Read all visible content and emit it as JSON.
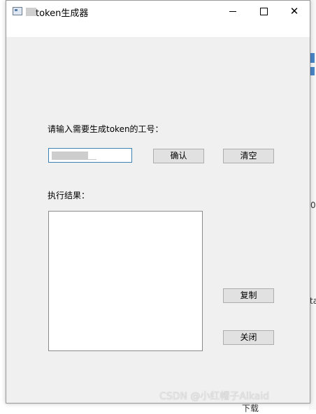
{
  "window": {
    "title": "token生成器"
  },
  "form": {
    "prompt_label": "请输入需要生成token的工号：",
    "input_value": "",
    "confirm_label": "确认",
    "clear_label": "清空",
    "result_label": "执行结果：",
    "copy_label": "复制",
    "close_label": "关闭"
  },
  "background": {
    "fragments": [
      "ta",
      "0",
      "下载"
    ]
  },
  "watermark": "CSDN @小红帽子Alkaid",
  "icons": [
    "app-icon",
    "minimize-icon",
    "maximize-icon",
    "close-icon"
  ]
}
